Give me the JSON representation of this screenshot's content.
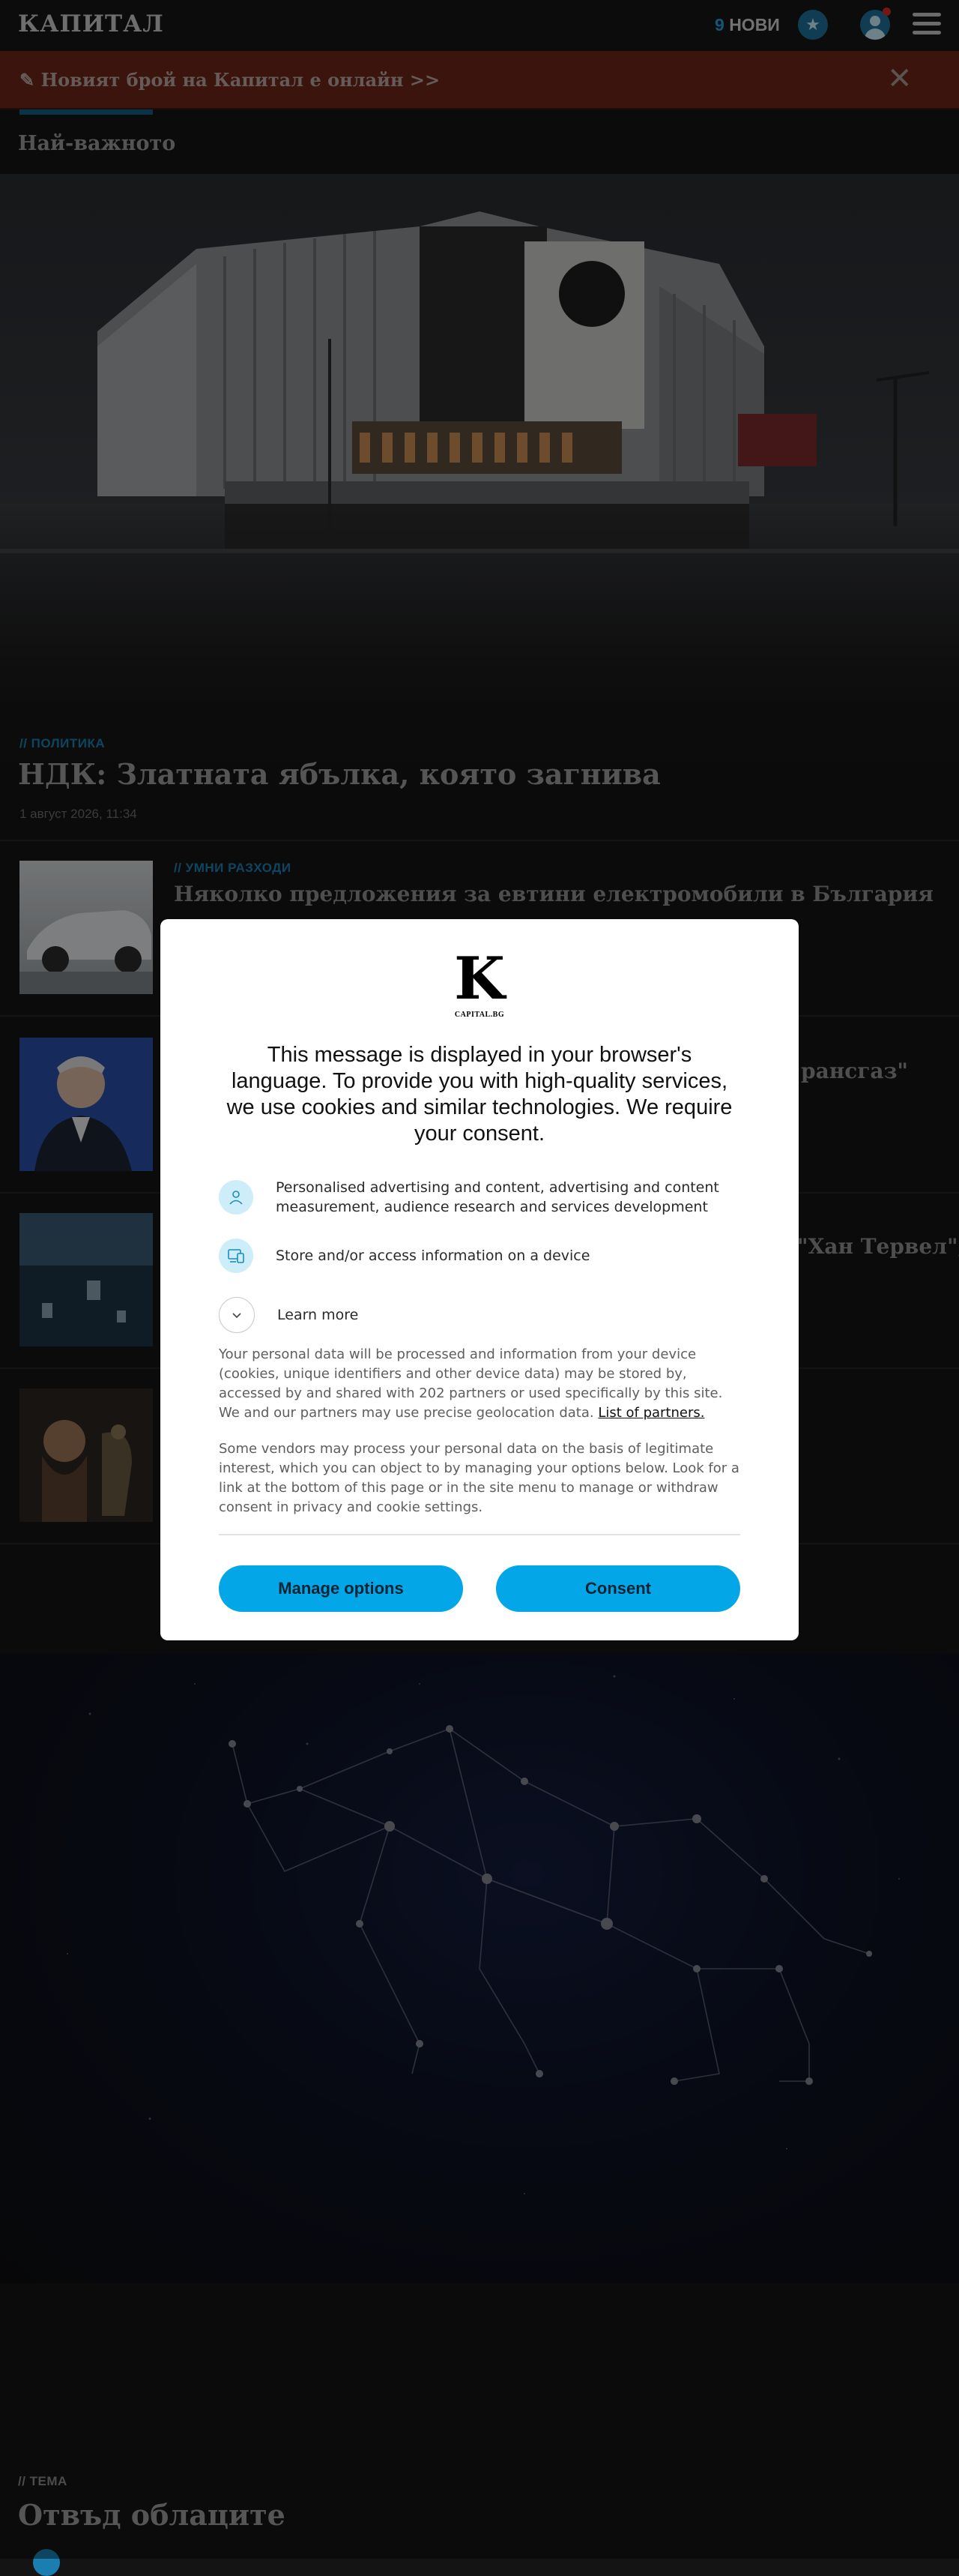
{
  "header": {
    "logo": "КАПИТАЛ",
    "new_count": "9",
    "new_label": "НОВИ"
  },
  "banner": {
    "text": "Новият брой на Капитал е онлайн >>"
  },
  "section": {
    "title": "Най-важното"
  },
  "hero": {
    "rubric": "// ПОЛИТИКА",
    "title": "НДК: Златната ябълка, която загнива",
    "date": "1 август 2026, 11:34"
  },
  "articles": [
    {
      "rubric": "// УМНИ РАЗХОДИ",
      "title": "Няколко предложения за евтини електромобили в България"
    },
    {
      "rubric": "",
      "title": "рансгаз\""
    },
    {
      "rubric": "",
      "title": "\"Хан Тервел\";"
    },
    {
      "rubric": "",
      "title": ""
    }
  ],
  "theme": {
    "label": "// ТЕМА",
    "title": "Отвъд облаците"
  },
  "consent": {
    "logo_letter": "K",
    "logo_sub": "CAPITAL.BG",
    "heading": "This message is displayed in your browser's language. To provide you with high-quality services, we use cookies and similar technologies. We require your consent.",
    "purposes": [
      "Personalised advertising and content, advertising and content measurement, audience research and services development",
      "Store and/or access information on a device"
    ],
    "learn_more": "Learn more",
    "para1": "Your personal data will be processed and information from your device (cookies, unique identifiers and other device data) may be stored by, accessed by and shared with 202 partners or used specifically by this site. We and our partners may use precise geolocation data.",
    "partners_link": "List of partners.",
    "para2": "Some vendors may process your personal data on the basis of legitimate interest, which you can object to by managing your options below. Look for a link at the bottom of this page or in the site menu to manage or withdraw consent in privacy and cookie settings.",
    "manage_label": "Manage options",
    "consent_label": "Consent"
  },
  "colors": {
    "accent": "#03a7e7",
    "banner": "#6a2519",
    "rubric": "#1a7fb0"
  }
}
